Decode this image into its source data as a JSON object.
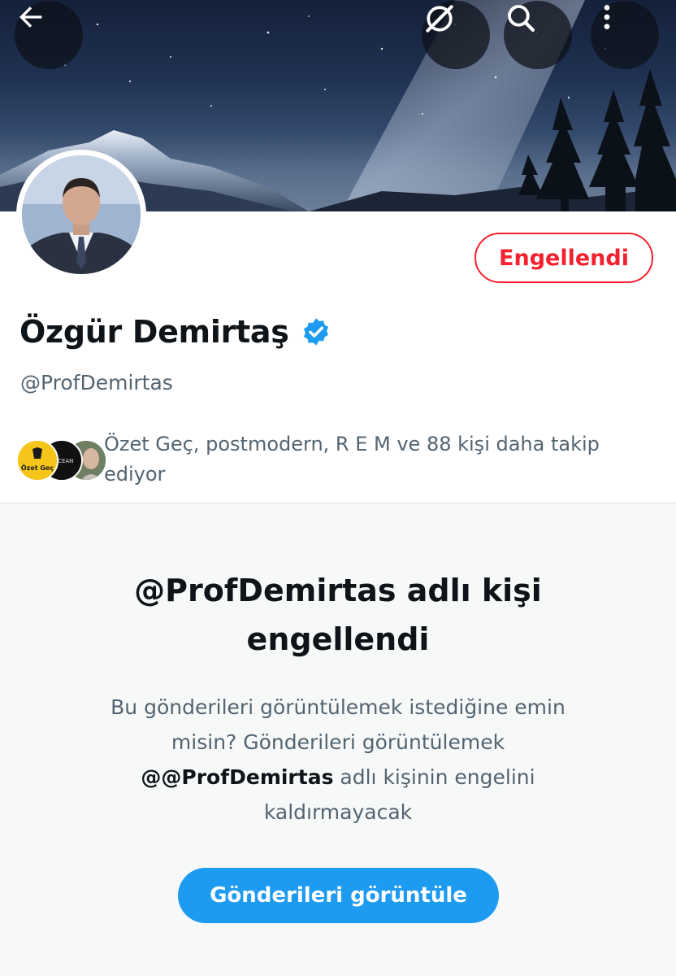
{
  "header": {
    "back_icon": "arrow-left-icon",
    "no_grok_icon": "slashed-circle-icon",
    "search_icon": "search-icon",
    "more_icon": "more-vertical-icon"
  },
  "profile": {
    "display_name": "Özgür Demirtaş",
    "verified": true,
    "handle": "@ProfDemirtas",
    "blocked_button_label": "Engellendi",
    "followers_you_know": {
      "text": "Özet Geç, postmodern, R E M ve 88 kişi daha takip ediyor",
      "avatars": [
        {
          "label": "Özet Geç",
          "color": "#f5c51a"
        },
        {
          "label": "OCEAN",
          "color": "#111111"
        },
        {
          "label": "",
          "color": "#7a8a6e"
        }
      ]
    }
  },
  "blocked_notice": {
    "title": "@ProfDemirtas adlı kişi engellendi",
    "desc_before": "Bu gönderileri görüntülemek istediğine emin misin? Gönderileri görüntülemek ",
    "desc_handle": "@@ProfDemirtas",
    "desc_after": " adlı kişinin engelini kaldırmayacak",
    "button_label": "Gönderileri görüntüle"
  },
  "colors": {
    "accent_blue": "#1d9bf0",
    "blocked_red": "#f4212e",
    "secondary_text": "#536471",
    "panel_bg": "#f7f9f9"
  }
}
